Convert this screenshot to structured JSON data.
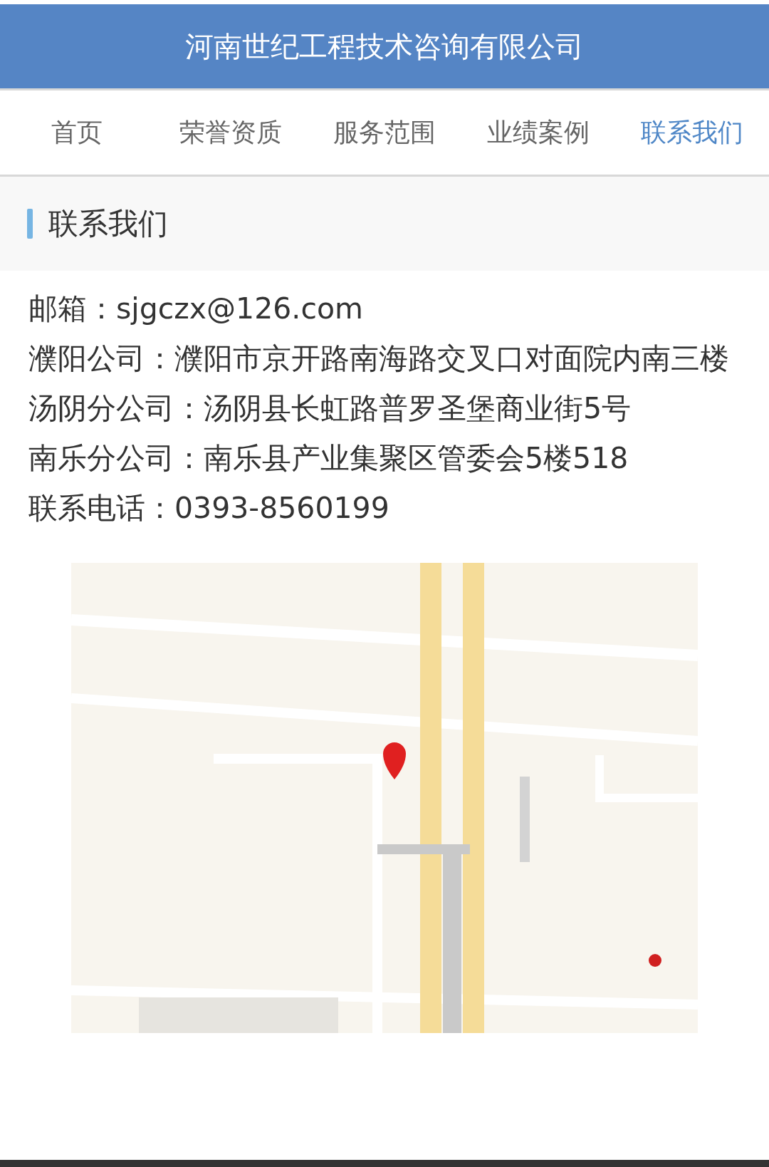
{
  "header": {
    "title": "河南世纪工程技术咨询有限公司"
  },
  "nav": [
    {
      "label": "首页",
      "selected": false
    },
    {
      "label": "荣誉资质",
      "selected": false
    },
    {
      "label": "服务范围",
      "selected": false
    },
    {
      "label": "业绩案例",
      "selected": false
    },
    {
      "label": "联系我们",
      "selected": true
    }
  ],
  "section": {
    "title": "联系我们"
  },
  "contacts": [
    {
      "text": "邮箱：sjgczx@126.com"
    },
    {
      "text": "濮阳公司：濮阳市京开路南海路交叉口对面院内南三楼"
    },
    {
      "text": "汤阴分公司：汤阴县长虹路普罗圣堡商业街5号"
    },
    {
      "text": "南乐分公司：南乐县产业集聚区管委会5楼518"
    },
    {
      "text": "联系电话：0393-8560199"
    }
  ]
}
